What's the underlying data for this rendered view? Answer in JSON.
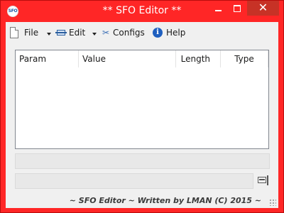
{
  "window": {
    "title": "** SFO Editor **",
    "app_icon_text": "SFO",
    "close_glyph": "✕",
    "accent_color": "#ff2626"
  },
  "toolbar": {
    "file_label": "File",
    "edit_label": "Edit",
    "configs_label": "Configs",
    "help_label": "Help",
    "help_glyph": "i",
    "configs_glyph": "✂"
  },
  "table": {
    "columns": [
      "Param",
      "Value",
      "Length",
      "Type"
    ],
    "rows": []
  },
  "status": {
    "text": ""
  },
  "path": {
    "value": ""
  },
  "footer": {
    "credit": "~ SFO Editor ~ Written by LMAN (C) 2015 ~"
  }
}
